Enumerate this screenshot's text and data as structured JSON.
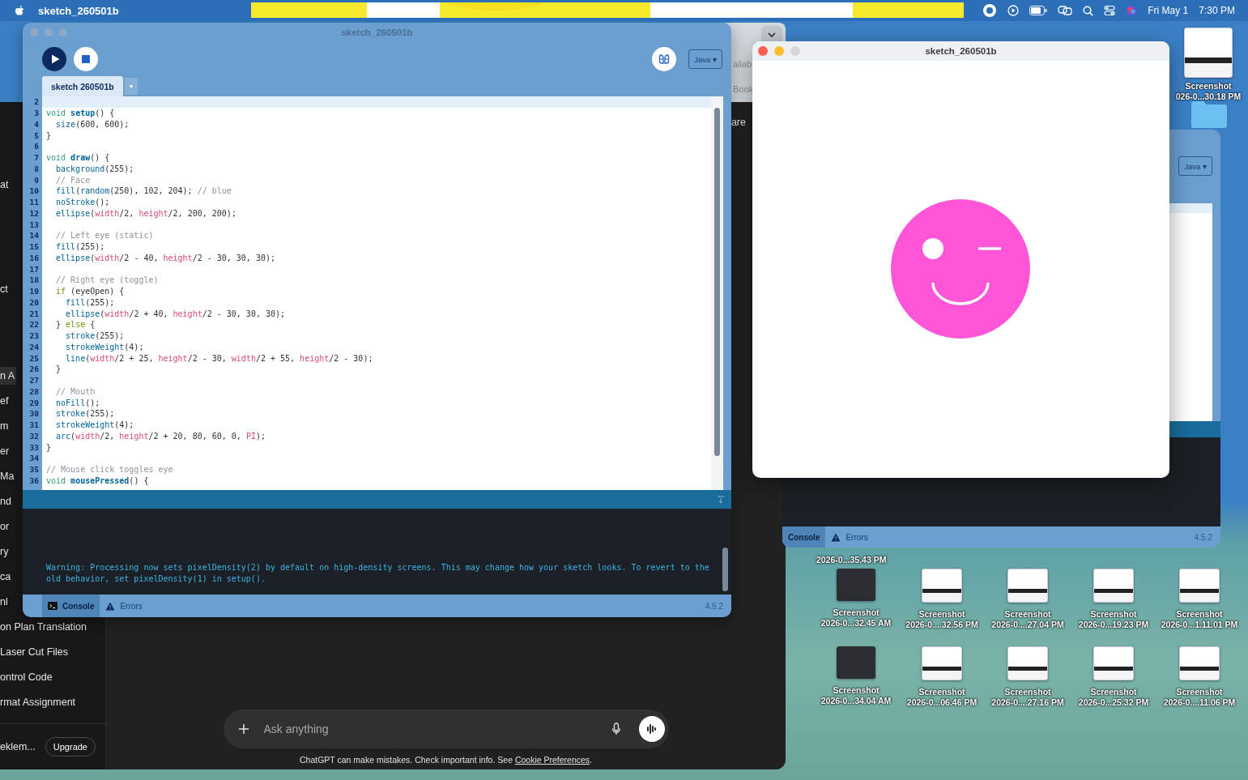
{
  "menu_bar": {
    "app_name": "sketch_260501b",
    "date": "Fri May 1",
    "time": "7:30 PM"
  },
  "browser_window": {
    "fragments": [
      "ailab",
      "Book"
    ]
  },
  "chatgpt_window": {
    "header_fragment": "are",
    "sidebar_sections": [
      {
        "items": [
          {
            "label": "at",
            "selected": false
          }
        ]
      },
      {
        "items": [
          {
            "label": "ct",
            "selected": false
          }
        ]
      },
      {
        "items": [
          {
            "label": "n A",
            "selected": true
          },
          {
            "label": "ef",
            "selected": false
          },
          {
            "label": "m",
            "selected": false
          },
          {
            "label": "er",
            "selected": false
          },
          {
            "label": "Ma",
            "selected": false
          },
          {
            "label": "nd",
            "selected": false
          },
          {
            "label": "or",
            "selected": false
          },
          {
            "label": "ry",
            "selected": false
          },
          {
            "label": "ca",
            "selected": false
          },
          {
            "label": "nl",
            "selected": false
          },
          {
            "label": "on Plan Translation",
            "selected": false
          },
          {
            "label": "Laser Cut Files",
            "selected": false
          },
          {
            "label": "ontrol Code",
            "selected": false
          },
          {
            "label": "rmat Assignment",
            "selected": false
          }
        ]
      }
    ],
    "account_name": "eklem...",
    "upgrade_button": "Upgrade",
    "composer": {
      "placeholder": "Ask anything"
    },
    "disclaimer": {
      "text": "ChatGPT can make mistakes. Check important info. See ",
      "link": "Cookie Preferences",
      "end": "."
    }
  },
  "processing_window": {
    "title": "sketch_260501b",
    "mode_button": "Java ▾",
    "tabs": [
      {
        "label": "sketch 260501b",
        "selected": true
      }
    ],
    "tab_menu": "▾",
    "code_lines": [
      {
        "number": "2",
        "current": true
      },
      {
        "number": "3",
        "current": false,
        "tokens": [
          {
            "text": "void ",
            "kind": "keyword"
          },
          {
            "text": "setup",
            "kind": "definition"
          },
          {
            "text": "() {",
            "kind": "plain"
          }
        ]
      },
      {
        "number": "4",
        "current": false,
        "tokens": [
          {
            "text": "  size",
            "kind": "function"
          },
          {
            "text": "(600, 600);",
            "kind": "plain"
          }
        ]
      },
      {
        "number": "5",
        "current": false,
        "tokens": [
          {
            "text": "}",
            "kind": "plain"
          }
        ]
      },
      {
        "number": "6",
        "current": false
      },
      {
        "number": "7",
        "current": false,
        "tokens": [
          {
            "text": "void ",
            "kind": "keyword"
          },
          {
            "text": "draw",
            "kind": "definition"
          },
          {
            "text": "() {",
            "kind": "plain"
          }
        ]
      },
      {
        "number": "8",
        "current": false,
        "tokens": [
          {
            "text": "  background",
            "kind": "function"
          },
          {
            "text": "(255);",
            "kind": "plain"
          }
        ]
      },
      {
        "number": "9",
        "current": false,
        "tokens": [
          {
            "text": "  // Face",
            "kind": "comment"
          }
        ]
      },
      {
        "number": "10",
        "current": false,
        "tokens": [
          {
            "text": "  fill",
            "kind": "function"
          },
          {
            "text": "(",
            "kind": "plain"
          },
          {
            "text": "random",
            "kind": "function"
          },
          {
            "text": "(250), 102, 204); ",
            "kind": "plain"
          },
          {
            "text": "// blue",
            "kind": "comment"
          }
        ]
      },
      {
        "number": "11",
        "current": false,
        "tokens": [
          {
            "text": "  noStroke",
            "kind": "function"
          },
          {
            "text": "();",
            "kind": "plain"
          }
        ]
      },
      {
        "number": "12",
        "current": false,
        "tokens": [
          {
            "text": "  ellipse",
            "kind": "function"
          },
          {
            "text": "(",
            "kind": "plain"
          },
          {
            "text": "width",
            "kind": "variable"
          },
          {
            "text": "/2, ",
            "kind": "plain"
          },
          {
            "text": "height",
            "kind": "variable"
          },
          {
            "text": "/2, 200, 200);",
            "kind": "plain"
          }
        ]
      },
      {
        "number": "13",
        "current": false
      },
      {
        "number": "14",
        "current": false,
        "tokens": [
          {
            "text": "  // Left eye (static)",
            "kind": "comment"
          }
        ]
      },
      {
        "number": "15",
        "current": false,
        "tokens": [
          {
            "text": "  fill",
            "kind": "function"
          },
          {
            "text": "(255);",
            "kind": "plain"
          }
        ]
      },
      {
        "number": "16",
        "current": false,
        "tokens": [
          {
            "text": "  ellipse",
            "kind": "function"
          },
          {
            "text": "(",
            "kind": "plain"
          },
          {
            "text": "width",
            "kind": "variable"
          },
          {
            "text": "/2 - 40, ",
            "kind": "plain"
          },
          {
            "text": "height",
            "kind": "variable"
          },
          {
            "text": "/2 - 30, 30, 30);",
            "kind": "plain"
          }
        ]
      },
      {
        "number": "17",
        "current": false
      },
      {
        "number": "18",
        "current": false,
        "tokens": [
          {
            "text": "  // Right eye (toggle)",
            "kind": "comment"
          }
        ]
      },
      {
        "number": "19",
        "current": false,
        "tokens": [
          {
            "text": "  if",
            "kind": "control"
          },
          {
            "text": " (eyeOpen) {",
            "kind": "plain"
          }
        ]
      },
      {
        "number": "20",
        "current": false,
        "tokens": [
          {
            "text": "    fill",
            "kind": "function"
          },
          {
            "text": "(255);",
            "kind": "plain"
          }
        ]
      },
      {
        "number": "21",
        "current": false,
        "tokens": [
          {
            "text": "    ellipse",
            "kind": "function"
          },
          {
            "text": "(",
            "kind": "plain"
          },
          {
            "text": "width",
            "kind": "variable"
          },
          {
            "text": "/2 + 40, ",
            "kind": "plain"
          },
          {
            "text": "height",
            "kind": "variable"
          },
          {
            "text": "/2 - 30, 30, 30);",
            "kind": "plain"
          }
        ]
      },
      {
        "number": "22",
        "current": false,
        "tokens": [
          {
            "text": "  } ",
            "kind": "plain"
          },
          {
            "text": "else",
            "kind": "control"
          },
          {
            "text": " {",
            "kind": "plain"
          }
        ]
      },
      {
        "number": "23",
        "current": false,
        "tokens": [
          {
            "text": "    stroke",
            "kind": "function"
          },
          {
            "text": "(255);",
            "kind": "plain"
          }
        ]
      },
      {
        "number": "24",
        "current": false,
        "tokens": [
          {
            "text": "    strokeWeight",
            "kind": "function"
          },
          {
            "text": "(4);",
            "kind": "plain"
          }
        ]
      },
      {
        "number": "25",
        "current": false,
        "tokens": [
          {
            "text": "    line",
            "kind": "function"
          },
          {
            "text": "(",
            "kind": "plain"
          },
          {
            "text": "width",
            "kind": "variable"
          },
          {
            "text": "/2 + 25, ",
            "kind": "plain"
          },
          {
            "text": "height",
            "kind": "variable"
          },
          {
            "text": "/2 - 30, ",
            "kind": "plain"
          },
          {
            "text": "width",
            "kind": "variable"
          },
          {
            "text": "/2 + 55, ",
            "kind": "plain"
          },
          {
            "text": "height",
            "kind": "variable"
          },
          {
            "text": "/2 - 30);",
            "kind": "plain"
          }
        ]
      },
      {
        "number": "26",
        "current": false,
        "tokens": [
          {
            "text": "  }",
            "kind": "plain"
          }
        ]
      },
      {
        "number": "27",
        "current": false
      },
      {
        "number": "28",
        "current": false,
        "tokens": [
          {
            "text": "  // Mouth",
            "kind": "comment"
          }
        ]
      },
      {
        "number": "29",
        "current": false,
        "tokens": [
          {
            "text": "  noFill",
            "kind": "function"
          },
          {
            "text": "();",
            "kind": "plain"
          }
        ]
      },
      {
        "number": "30",
        "current": false,
        "tokens": [
          {
            "text": "  stroke",
            "kind": "function"
          },
          {
            "text": "(255);",
            "kind": "plain"
          }
        ]
      },
      {
        "number": "31",
        "current": false,
        "tokens": [
          {
            "text": "  strokeWeight",
            "kind": "function"
          },
          {
            "text": "(4);",
            "kind": "plain"
          }
        ]
      },
      {
        "number": "32",
        "current": false,
        "tokens": [
          {
            "text": "  arc",
            "kind": "function"
          },
          {
            "text": "(",
            "kind": "plain"
          },
          {
            "text": "width",
            "kind": "variable"
          },
          {
            "text": "/2, ",
            "kind": "plain"
          },
          {
            "text": "height",
            "kind": "variable"
          },
          {
            "text": "/2 + 20, 80, 60, 0, ",
            "kind": "plain"
          },
          {
            "text": "PI",
            "kind": "variable"
          },
          {
            "text": ");",
            "kind": "plain"
          }
        ]
      },
      {
        "number": "33",
        "current": false,
        "tokens": [
          {
            "text": "}",
            "kind": "plain"
          }
        ]
      },
      {
        "number": "34",
        "current": false
      },
      {
        "number": "35",
        "current": false,
        "tokens": [
          {
            "text": "// Mouse click toggles eye",
            "kind": "comment"
          }
        ]
      },
      {
        "number": "36",
        "current": false,
        "tokens": [
          {
            "text": "void ",
            "kind": "keyword"
          },
          {
            "text": "mousePressed",
            "kind": "definition"
          },
          {
            "text": "() {",
            "kind": "plain"
          }
        ]
      }
    ],
    "console_message": "Warning: Processing now sets pixelDensity(2) by default on high-density screens. This may change how your sketch looks. To revert to the old behavior, set pixelDensity(1) in setup().",
    "bottom_tabs": [
      {
        "label": "Console",
        "kind": "console",
        "selected": true
      },
      {
        "label": "Errors",
        "kind": "errors",
        "selected": false
      }
    ],
    "version": "4.5.2"
  },
  "sketch_window": {
    "title": "sketch_260501b",
    "face": {
      "right_eye_open": false
    }
  },
  "second_processing_window": {
    "mode_button": "Java ▾",
    "bottom_tabs": [
      {
        "label": "Console",
        "kind": "console",
        "selected": true
      },
      {
        "label": "Errors",
        "kind": "errors",
        "selected": false
      }
    ],
    "version": "4.5.2"
  },
  "desktop": {
    "top_icon": {
      "title": "Screenshot",
      "subtitle": "026-0...30.18 PM"
    },
    "partial_label": "2026-0...35.43 PM",
    "icons": [
      {
        "title": "Screenshot",
        "subtitle": "2026-0...32.45 AM",
        "kind": "dark"
      },
      {
        "title": "Screenshot",
        "subtitle": "2026-0....32.56 PM",
        "kind": "light"
      },
      {
        "title": "Screenshot",
        "subtitle": "2026-0....27.04 PM",
        "kind": "light"
      },
      {
        "title": "Screenshot",
        "subtitle": "2026-0...19.23 PM",
        "kind": "light"
      },
      {
        "title": "Screenshot",
        "subtitle": "2026-0...1.11.01 PM",
        "kind": "light"
      },
      {
        "title": "Screenshot",
        "subtitle": "2026-0...34.04 AM",
        "kind": "dark"
      },
      {
        "title": "Screenshot",
        "subtitle": "2026-0...06.46 PM",
        "kind": "light"
      },
      {
        "title": "Screenshot",
        "subtitle": "2026-0....27.16 PM",
        "kind": "light"
      },
      {
        "title": "Screenshot",
        "subtitle": "2026-0...25.32 PM",
        "kind": "light"
      },
      {
        "title": "Screenshot",
        "subtitle": "2026-0....11.06 PM",
        "kind": "light"
      }
    ]
  }
}
